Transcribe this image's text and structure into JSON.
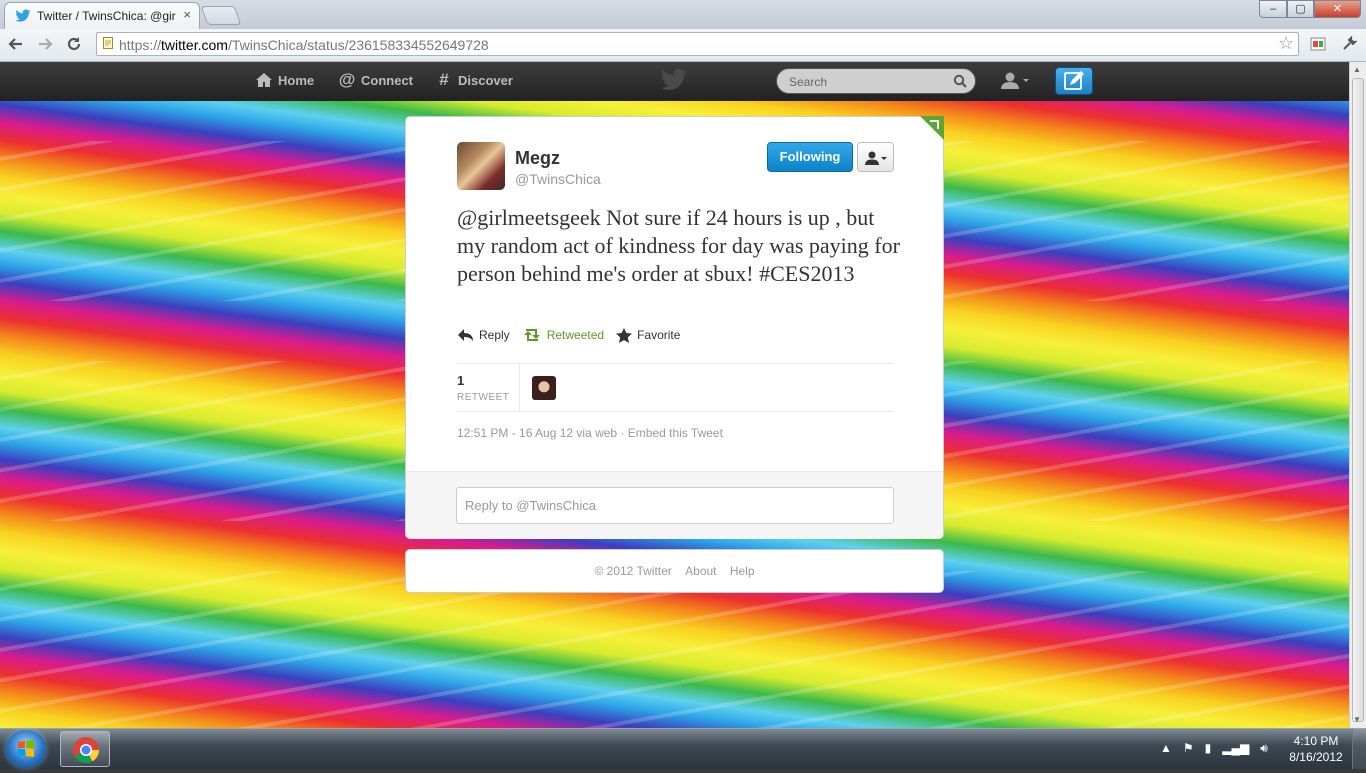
{
  "browser": {
    "tab_title": "Twitter / TwinsChica: @gir",
    "tab_close": "×",
    "url_scheme": "https://",
    "url_host": "twitter.com",
    "url_path": "/TwinsChica/status/236158334552649728",
    "back_icon": "back-arrow-icon",
    "forward_icon": "forward-arrow-icon",
    "reload_icon": "reload-icon",
    "star_icon": "bookmark-star-icon",
    "window_min": "–",
    "window_max": "▢",
    "window_close": "✕"
  },
  "twitter_nav": {
    "home": "Home",
    "connect": "Connect",
    "discover": "Discover",
    "search_placeholder": "Search"
  },
  "tweet": {
    "name": "Megz",
    "handle": "@TwinsChica",
    "follow_label": "Following",
    "text_mention": "@girlmeetsgeek",
    "text_body": " Not sure if 24 hours is up , but my random act of kindness for day was paying for person behind me's order at sbux! ",
    "text_hashtag": "#CES2013",
    "actions": {
      "reply": "Reply",
      "retweeted": "Retweeted",
      "favorite": "Favorite"
    },
    "retweet_count": "1",
    "retweet_label": "RETWEET",
    "meta_time": "12:51 PM - 16 Aug 12 via web",
    "meta_sep": " · ",
    "meta_embed": "Embed this Tweet",
    "reply_placeholder": "Reply to @TwinsChica"
  },
  "footer": {
    "copyright": "© 2012 Twitter",
    "about": "About",
    "help": "Help"
  },
  "taskbar": {
    "time": "4:10 PM",
    "date": "8/16/2012",
    "tray_expand": "▲"
  },
  "colors": {
    "twitter_blue": "#0b83c9",
    "retweeted_green": "#609928",
    "topbar": "#222222"
  }
}
